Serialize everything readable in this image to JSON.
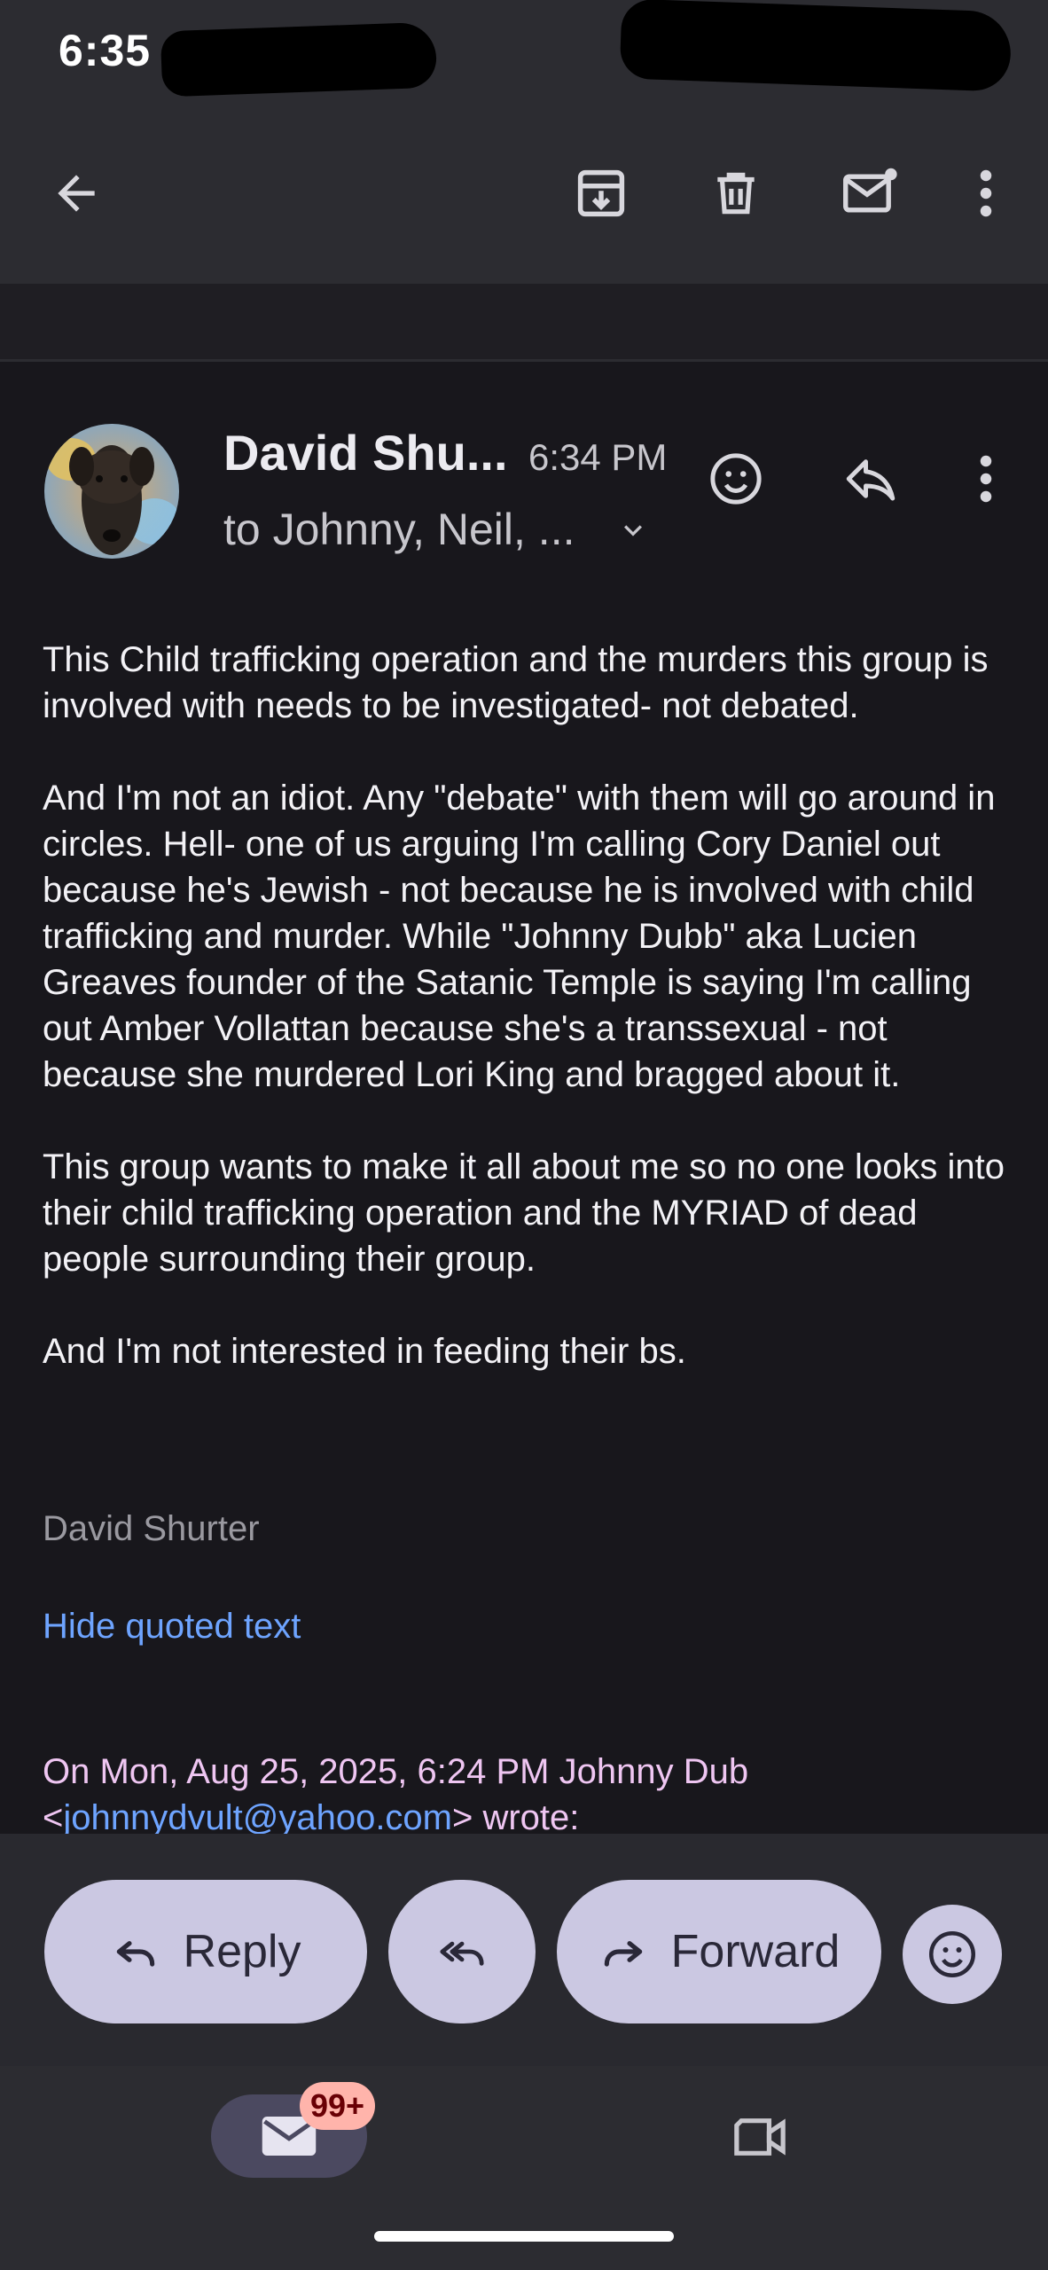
{
  "status_bar": {
    "time": "6:35"
  },
  "toolbar": {
    "back_icon": "arrow-back-icon",
    "archive_icon": "archive-icon",
    "delete_icon": "trash-icon",
    "mark_unread_icon": "mark-unread-icon",
    "more_icon": "more-vert-icon"
  },
  "message": {
    "sender_name": "David Shu...",
    "time": "6:34 PM",
    "recipients": "to Johnny, Neil, ...",
    "body_paragraphs": [
      "This Child trafficking operation and the murders this group is involved with needs to be investigated- not debated.",
      "And I'm not an idiot. Any \"debate\" with them will go around in circles. Hell- one of us arguing I'm calling Cory Daniel out because he's Jewish - not because he is involved with child trafficking and murder. While \"Johnny Dubb\" aka Lucien Greaves founder of the Satanic Temple is saying I'm calling out Amber Vollattan because she's a transsexual - not because she murdered Lori King and bragged about it.",
      "This group wants to make it all about me so no one looks into their child trafficking operation and the MYRIAD of dead people surrounding their group.",
      "And I'm not interested in feeding their bs."
    ],
    "signature": "David Shurter",
    "hide_quoted": "Hide quoted text",
    "quote_prefix": "On Mon, Aug 25, 2025, 6:24 PM Johnny Dub",
    "quote_open": "<",
    "quote_email": "johnnydvult@yahoo.com",
    "quote_suffix": "> wrote:"
  },
  "actions": {
    "reply_label": "Reply",
    "forward_label": "Forward"
  },
  "bottom_nav": {
    "mail_badge": "99+"
  },
  "colors": {
    "background": "#18171c",
    "pill": "#cbc8e2",
    "link": "#6ea4ff",
    "quote_text": "#efc6f2",
    "badge": "#ffb4ab"
  }
}
